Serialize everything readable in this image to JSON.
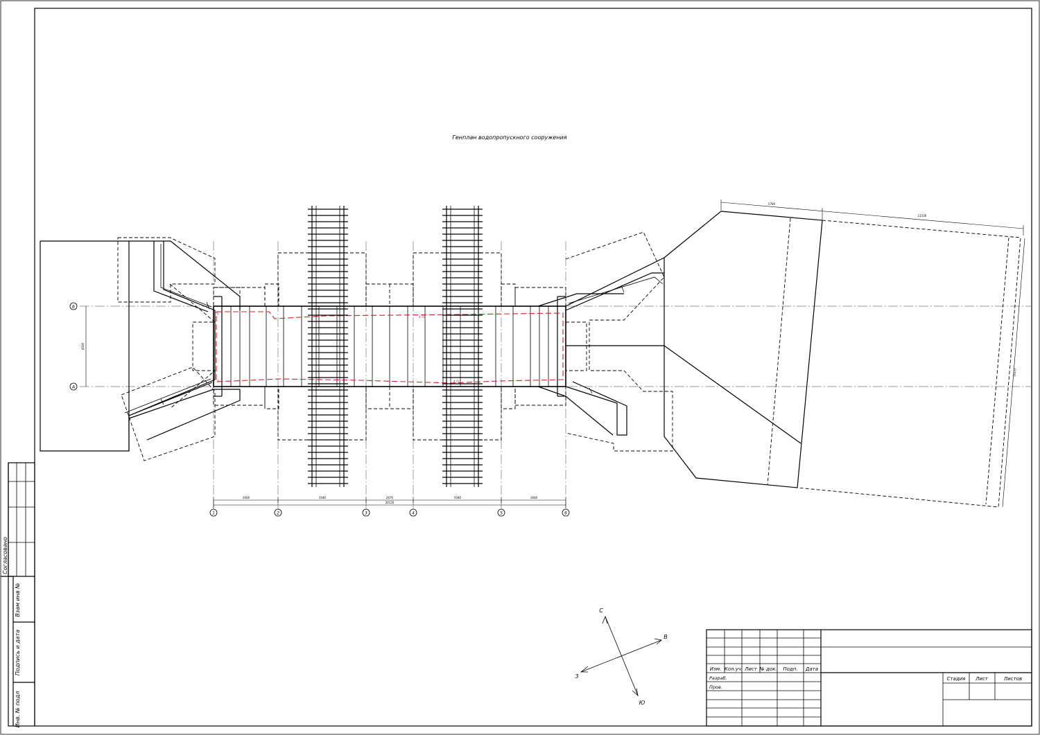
{
  "title": "Генплан водопропускного сооружения",
  "grid_axes_vertical": [
    {
      "label": "1"
    },
    {
      "label": "2"
    },
    {
      "label": "3"
    },
    {
      "label": "4"
    },
    {
      "label": "5"
    },
    {
      "label": "6"
    }
  ],
  "grid_axes_horizontal": [
    {
      "label": "Б"
    },
    {
      "label": "А"
    }
  ],
  "dimensions": {
    "spans": [
      "3600",
      "5040",
      "2670",
      "5040",
      "3600"
    ],
    "total": "20120",
    "between_rows": "4500",
    "right_top_a": "5780",
    "right_top_b": "11536",
    "right_side": "11700"
  },
  "pipe_labels": {
    "left_top": "Б",
    "left_bottom": "А",
    "mid_top": "4,51",
    "mid_bottom": "4,51"
  },
  "compass": {
    "north": "С",
    "east": "В",
    "west": "З",
    "south": "Ю"
  },
  "left_margin": {
    "agreed": "Согласовано",
    "replaced_inv": "Взам инв №",
    "signature_date": "Подпись и дата",
    "inv_no_orig": "Инв. № подл"
  },
  "title_block": {
    "headers": [
      "Изм.",
      "Кол.уч.",
      "Лист",
      "№ док.",
      "Подп.",
      "Дата"
    ],
    "rows": [
      "Разраб.",
      "Пров."
    ],
    "stage": "Стадия",
    "sheet": "Лист",
    "sheets": "Листов"
  }
}
